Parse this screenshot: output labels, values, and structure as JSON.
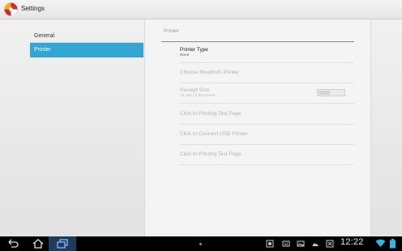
{
  "action_bar": {
    "title": "Settings"
  },
  "nav": {
    "items": [
      {
        "label": "General",
        "selected": false
      },
      {
        "label": "Printer",
        "selected": true
      }
    ]
  },
  "panel": {
    "title": "Printer",
    "prefs": [
      {
        "title": "Printer Type",
        "summary": "None",
        "enabled": true
      },
      {
        "title": "Choose Bluetooth Printer",
        "summary": "",
        "enabled": false
      },
      {
        "title": "Receipt Size",
        "summary": "72 mm / 2.83 inches",
        "enabled": false,
        "toggle_label": "L"
      },
      {
        "title": "Click to Printing Test Page",
        "summary": "",
        "enabled": false
      },
      {
        "title": "Click to Connect USB Printer",
        "summary": "",
        "enabled": false
      },
      {
        "title": "Click to Printing Test Page",
        "summary": "",
        "enabled": false
      }
    ]
  },
  "system_bar": {
    "clock": "12:22",
    "icons": [
      "back-icon",
      "home-icon",
      "recent-apps-icon",
      "menu-dot-icon",
      "screenshot-icon",
      "keyboard-icon",
      "gallery-icon",
      "image-icon",
      "cross-app-icon",
      "wifi-icon",
      "battery-icon"
    ]
  },
  "colors": {
    "accent": "#33a6d6",
    "navbar": "#000000"
  }
}
